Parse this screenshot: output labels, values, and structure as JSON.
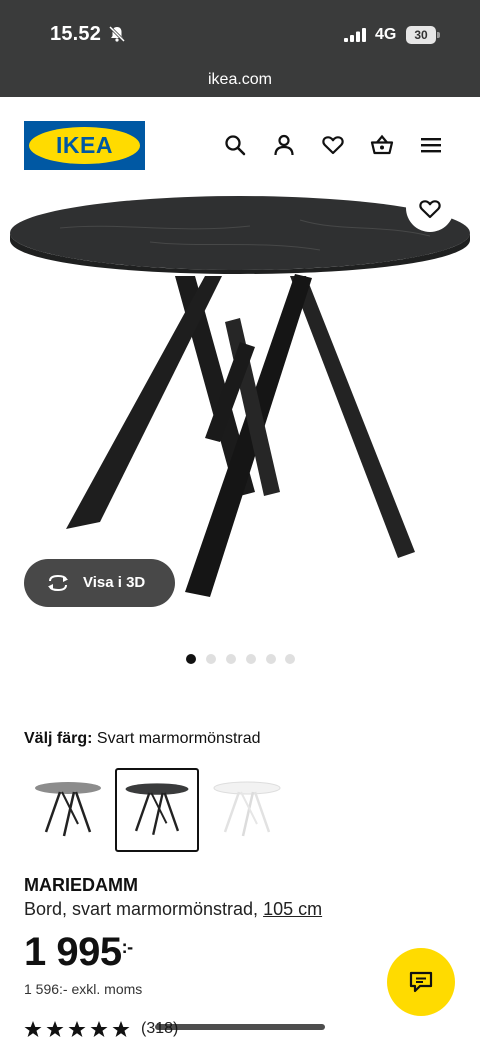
{
  "status_bar": {
    "time": "15.52",
    "network": "4G",
    "battery": "30"
  },
  "url_bar": {
    "domain": "ikea.com"
  },
  "header": {
    "logo_text": "IKEA",
    "icons": [
      "search-icon",
      "user-icon",
      "heart-icon",
      "basket-icon",
      "menu-icon"
    ]
  },
  "gallery": {
    "view_3d_label": "Visa i 3D",
    "image_count": 6,
    "active_index": 0
  },
  "color": {
    "label": "Välj färg:",
    "value": "Svart marmormönstrad",
    "swatches": [
      "Grå",
      "Svart marmormönstrad",
      "Vit"
    ],
    "selected_index": 1
  },
  "product": {
    "name": "MARIEDAMM",
    "description": "Bord, svart marmormönstrad,",
    "size": "105 cm",
    "price": "1 995",
    "price_suffix": ":-",
    "price_excl": "1 596:- exkl. moms",
    "rating": 5,
    "rating_count": "(318)"
  },
  "colors": {
    "brand_blue": "#0058a3",
    "brand_yellow": "#ffdb00",
    "chrome": "#3a3b3b"
  }
}
